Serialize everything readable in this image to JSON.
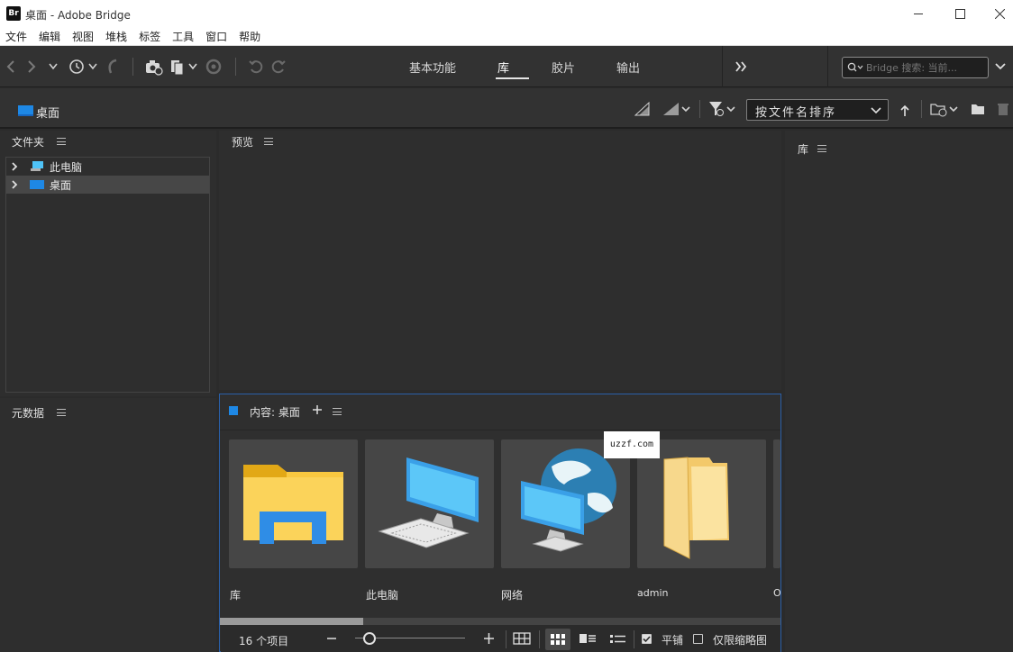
{
  "window": {
    "logo": "Br",
    "title": "桌面 - Adobe Bridge"
  },
  "menu": [
    "文件",
    "编辑",
    "视图",
    "堆栈",
    "标签",
    "工具",
    "窗口",
    "帮助"
  ],
  "workspaces": {
    "tabs": [
      "基本功能",
      "库",
      "胶片",
      "输出"
    ],
    "active": "库"
  },
  "search": {
    "placeholder": "Bridge 搜索: 当前..."
  },
  "path": {
    "current": "桌面"
  },
  "sort": {
    "selected": "按文件名排序"
  },
  "panels": {
    "folders_title": "文件夹",
    "preview_title": "预览",
    "library_title": "库",
    "metadata_title": "元数据",
    "content_title": "内容: 桌面"
  },
  "folder_tree": [
    {
      "label": "此电脑",
      "icon": "computer-icon",
      "selected": false
    },
    {
      "label": "桌面",
      "icon": "desktop-icon",
      "selected": true
    }
  ],
  "content_items": [
    {
      "label": "库",
      "icon": "library-folder-icon"
    },
    {
      "label": "此电脑",
      "icon": "computer-icon"
    },
    {
      "label": "网络",
      "icon": "network-icon"
    },
    {
      "label": "admin",
      "icon": "folder-icon"
    },
    {
      "label": "O",
      "icon": "partial-item"
    }
  ],
  "watermark": "uzzf.com",
  "footer": {
    "count": "16 个项目",
    "tile_label": "平铺",
    "thumbs_only_label": "仅限缩略图",
    "tile_checked": true,
    "thumbs_only_checked": false,
    "thumbnail_slider": 0.08
  },
  "colors": {
    "accent_blue": "#1e88e5",
    "panel_bg": "#2e2e2e",
    "toolbar_bg": "#323232"
  }
}
